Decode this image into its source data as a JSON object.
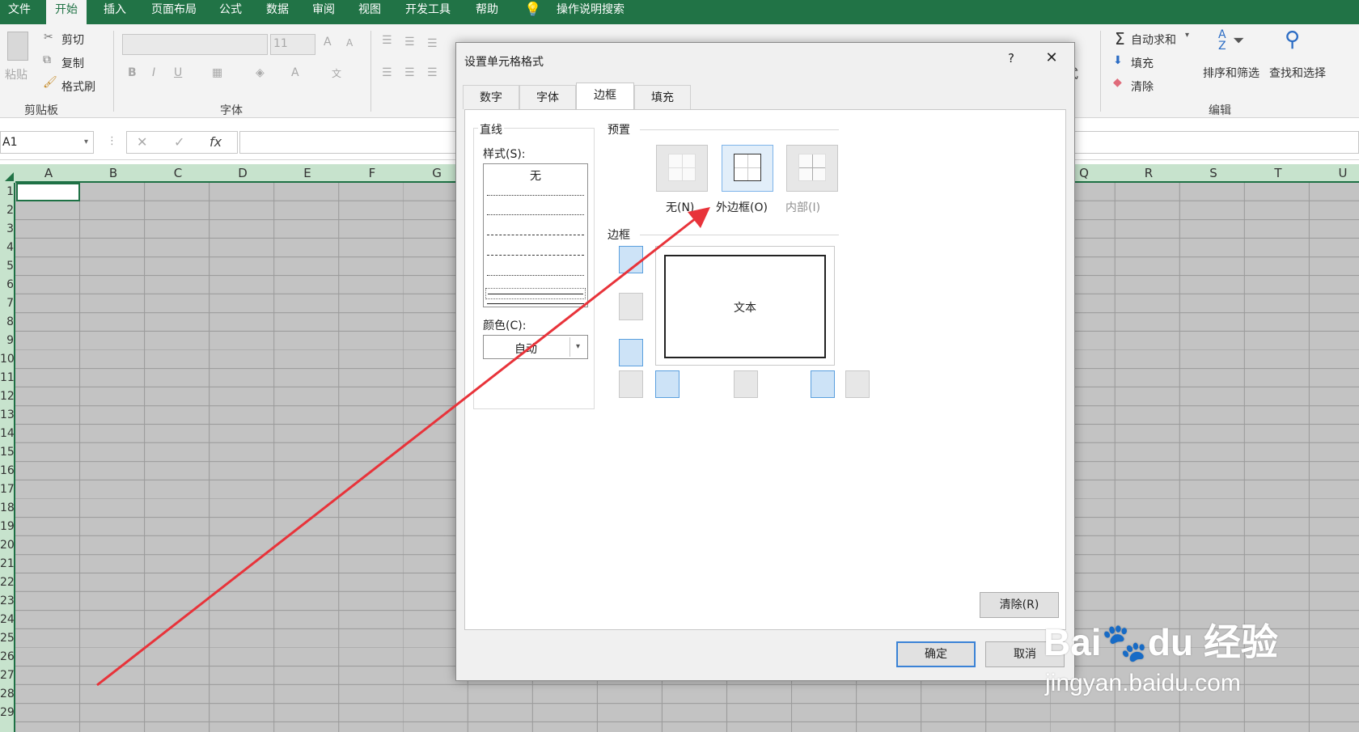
{
  "menu": {
    "tabs": [
      "文件",
      "开始",
      "插入",
      "页面布局",
      "公式",
      "数据",
      "审阅",
      "视图",
      "开发工具",
      "帮助"
    ],
    "active": "开始",
    "tell_me": "操作说明搜索"
  },
  "ribbon": {
    "clipboard": {
      "paste": "粘贴",
      "cut": "剪切",
      "copy": "复制",
      "format_painter": "格式刷",
      "group": "剪贴板"
    },
    "font": {
      "size": "11",
      "group": "字体",
      "bold": "B",
      "italic": "I",
      "underline": "U"
    },
    "editing": {
      "autosum": "自动求和",
      "fill": "填充",
      "clear": "清除",
      "sort_filter": "排序和筛选",
      "find_select": "查找和选择",
      "group": "编辑"
    },
    "format_partial": "式"
  },
  "formula_bar": {
    "name_box": "A1",
    "fx": "fx"
  },
  "sheet": {
    "columns": [
      "A",
      "B",
      "C",
      "D",
      "E",
      "F",
      "G",
      "Q",
      "R",
      "S",
      "T",
      "U"
    ],
    "rows": [
      "1",
      "2",
      "3",
      "4",
      "5",
      "6",
      "7",
      "8",
      "9",
      "10",
      "11",
      "12",
      "13",
      "14",
      "15",
      "16",
      "17",
      "18",
      "19",
      "20",
      "21",
      "22",
      "23",
      "24",
      "25",
      "26",
      "27",
      "28",
      "29"
    ]
  },
  "dialog": {
    "title": "设置单元格格式",
    "help": "?",
    "close": "✕",
    "tabs": [
      "数字",
      "字体",
      "边框",
      "填充"
    ],
    "active_tab": "边框",
    "line": {
      "section": "直线",
      "style_label": "样式(S):",
      "none": "无",
      "color_label": "颜色(C):",
      "color_value": "自动"
    },
    "presets": {
      "section": "预置",
      "none": "无(N)",
      "outline": "外边框(O)",
      "inside": "内部(I)"
    },
    "border": {
      "section": "边框",
      "preview_text": "文本"
    },
    "clear_button": "清除(R)",
    "ok": "确定",
    "cancel": "取消"
  },
  "watermark": {
    "brand": "Bai",
    "brand2": "du",
    "cn": "经验",
    "url": "jingyan.baidu.com"
  },
  "colors": {
    "excel_green": "#217346",
    "arrow": "#e8333a",
    "selected_blue": "#cde3f7"
  }
}
